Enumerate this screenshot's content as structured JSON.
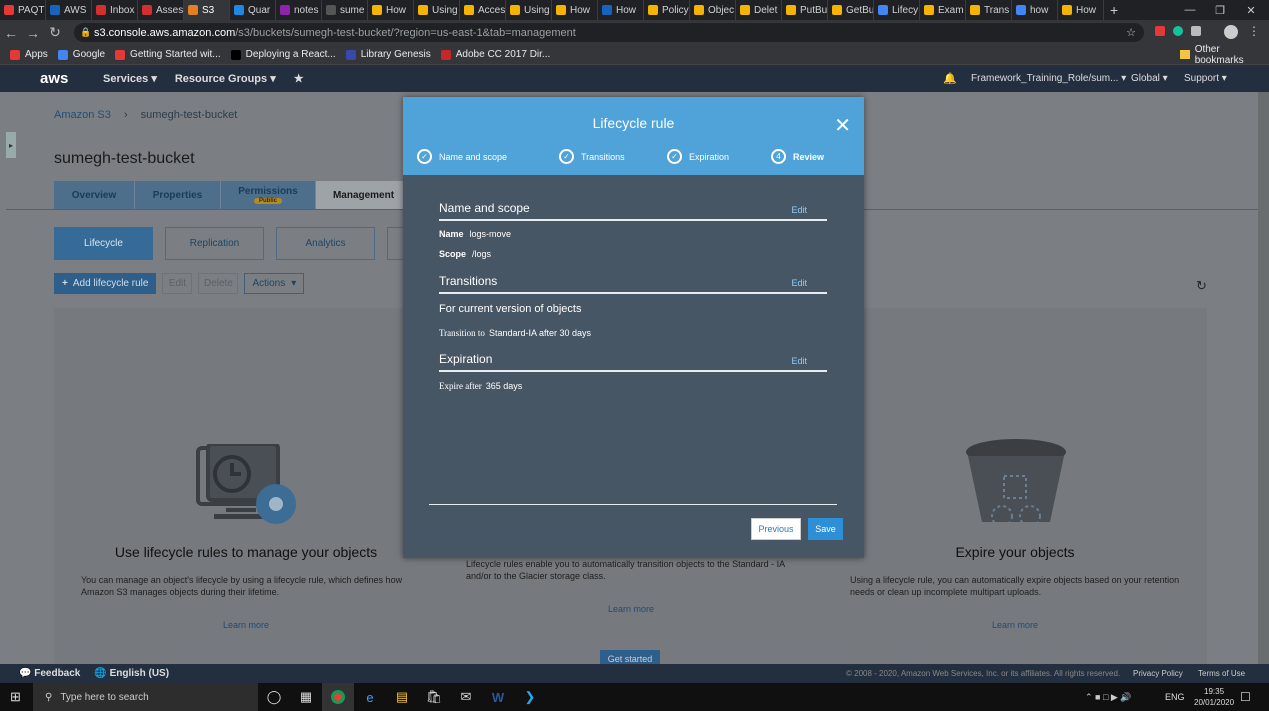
{
  "browser": {
    "tabs": [
      {
        "label": "PAQT",
        "color": "#e53935"
      },
      {
        "label": "AWS",
        "color": "#1565c0"
      },
      {
        "label": "Inbox",
        "color": "#d32f2f"
      },
      {
        "label": "Asses",
        "color": "#d32f2f"
      },
      {
        "label": "S3",
        "color": "#e67e22",
        "active": true
      },
      {
        "label": "Quar",
        "color": "#1e88e5"
      },
      {
        "label": "notes",
        "color": "#8e24aa"
      },
      {
        "label": "sume",
        "color": "#555555"
      },
      {
        "label": "How",
        "color": "#f4b400"
      },
      {
        "label": "Using",
        "color": "#f4b400"
      },
      {
        "label": "Acces",
        "color": "#f4b400"
      },
      {
        "label": "Using",
        "color": "#f4b400"
      },
      {
        "label": "How",
        "color": "#f4b400"
      },
      {
        "label": "How",
        "color": "#1565c0"
      },
      {
        "label": "Policy",
        "color": "#f4b400"
      },
      {
        "label": "Objec",
        "color": "#f4b400"
      },
      {
        "label": "Delet",
        "color": "#f4b400"
      },
      {
        "label": "PutBu",
        "color": "#f4b400"
      },
      {
        "label": "GetBu",
        "color": "#f4b400"
      },
      {
        "label": "Lifecy",
        "color": "#4285f4"
      },
      {
        "label": "Exam",
        "color": "#f4b400"
      },
      {
        "label": "Trans",
        "color": "#f4b400"
      },
      {
        "label": "how",
        "color": "#4285f4"
      },
      {
        "label": "How",
        "color": "#f4b400"
      }
    ],
    "url_host": "s3.console.aws.amazon.com",
    "url_path": "/s3/buckets/sumegh-test-bucket/?region=us-east-1&tab=management",
    "bookmarks": [
      {
        "label": "Apps",
        "color": "#e53935"
      },
      {
        "label": "Google",
        "color": "#4285f4"
      },
      {
        "label": "Getting Started wit...",
        "color": "#e53935"
      },
      {
        "label": "Deploying a React...",
        "color": "#000000"
      },
      {
        "label": "Library Genesis",
        "color": "#3949ab"
      },
      {
        "label": "Adobe CC 2017 Dir...",
        "color": "#c62828"
      }
    ],
    "other_bookmarks": "Other bookmarks"
  },
  "aws_nav": {
    "logo": "aws",
    "services": "Services",
    "resource_groups": "Resource Groups",
    "role": "Framework_Training_Role/sum...",
    "region": "Global",
    "support": "Support"
  },
  "breadcrumb": {
    "root": "Amazon S3",
    "current": "sumegh-test-bucket"
  },
  "bucket_name": "sumegh-test-bucket",
  "page_tabs": [
    "Overview",
    "Properties",
    "Permissions",
    "Management"
  ],
  "permissions_badge": "Public",
  "sub_tabs": [
    "Lifecycle",
    "Replication",
    "Analytics"
  ],
  "toolbar": {
    "add": "Add lifecycle rule",
    "edit": "Edit",
    "delete": "Delete",
    "actions": "Actions"
  },
  "features": [
    {
      "title": "Use lifecycle rules to manage your objects",
      "text": "You can manage an object's lifecycle by using a lifecycle rule, which defines how Amazon S3 manages objects during their lifetime.",
      "link": "Learn more"
    },
    {
      "title": "",
      "text": "Lifecycle rules enable you to automatically transition objects to the Standard - IA and/or to the Glacier storage class.",
      "link": "Learn more"
    },
    {
      "title": "Expire your objects",
      "text": "Using a lifecycle rule, you can automatically expire objects based on your retention needs or clean up incomplete multipart uploads.",
      "link": "Learn more"
    }
  ],
  "get_started": "Get started",
  "modal": {
    "title": "Lifecycle rule",
    "steps": [
      "Name and scope",
      "Transitions",
      "Expiration",
      "Review"
    ],
    "review_step_number": "4",
    "name_scope": {
      "heading": "Name and scope",
      "edit": "Edit",
      "name_label": "Name",
      "name_value": "logs-move",
      "scope_label": "Scope",
      "scope_value": "/logs"
    },
    "transitions": {
      "heading": "Transitions",
      "edit": "Edit",
      "subheading": "For current version of objects",
      "label": "Transition to",
      "value": "Standard-IA after 30 days"
    },
    "expiration": {
      "heading": "Expiration",
      "edit": "Edit",
      "label": "Expire after",
      "value": "365 days"
    },
    "previous": "Previous",
    "save": "Save"
  },
  "footer": {
    "feedback": "Feedback",
    "language": "English (US)",
    "copyright": "© 2008 - 2020, Amazon Web Services, Inc. or its affiliates. All rights reserved.",
    "privacy": "Privacy Policy",
    "terms": "Terms of Use"
  },
  "taskbar": {
    "search_placeholder": "Type here to search",
    "lang": "ENG",
    "time": "19:35",
    "date": "20/01/2020"
  }
}
